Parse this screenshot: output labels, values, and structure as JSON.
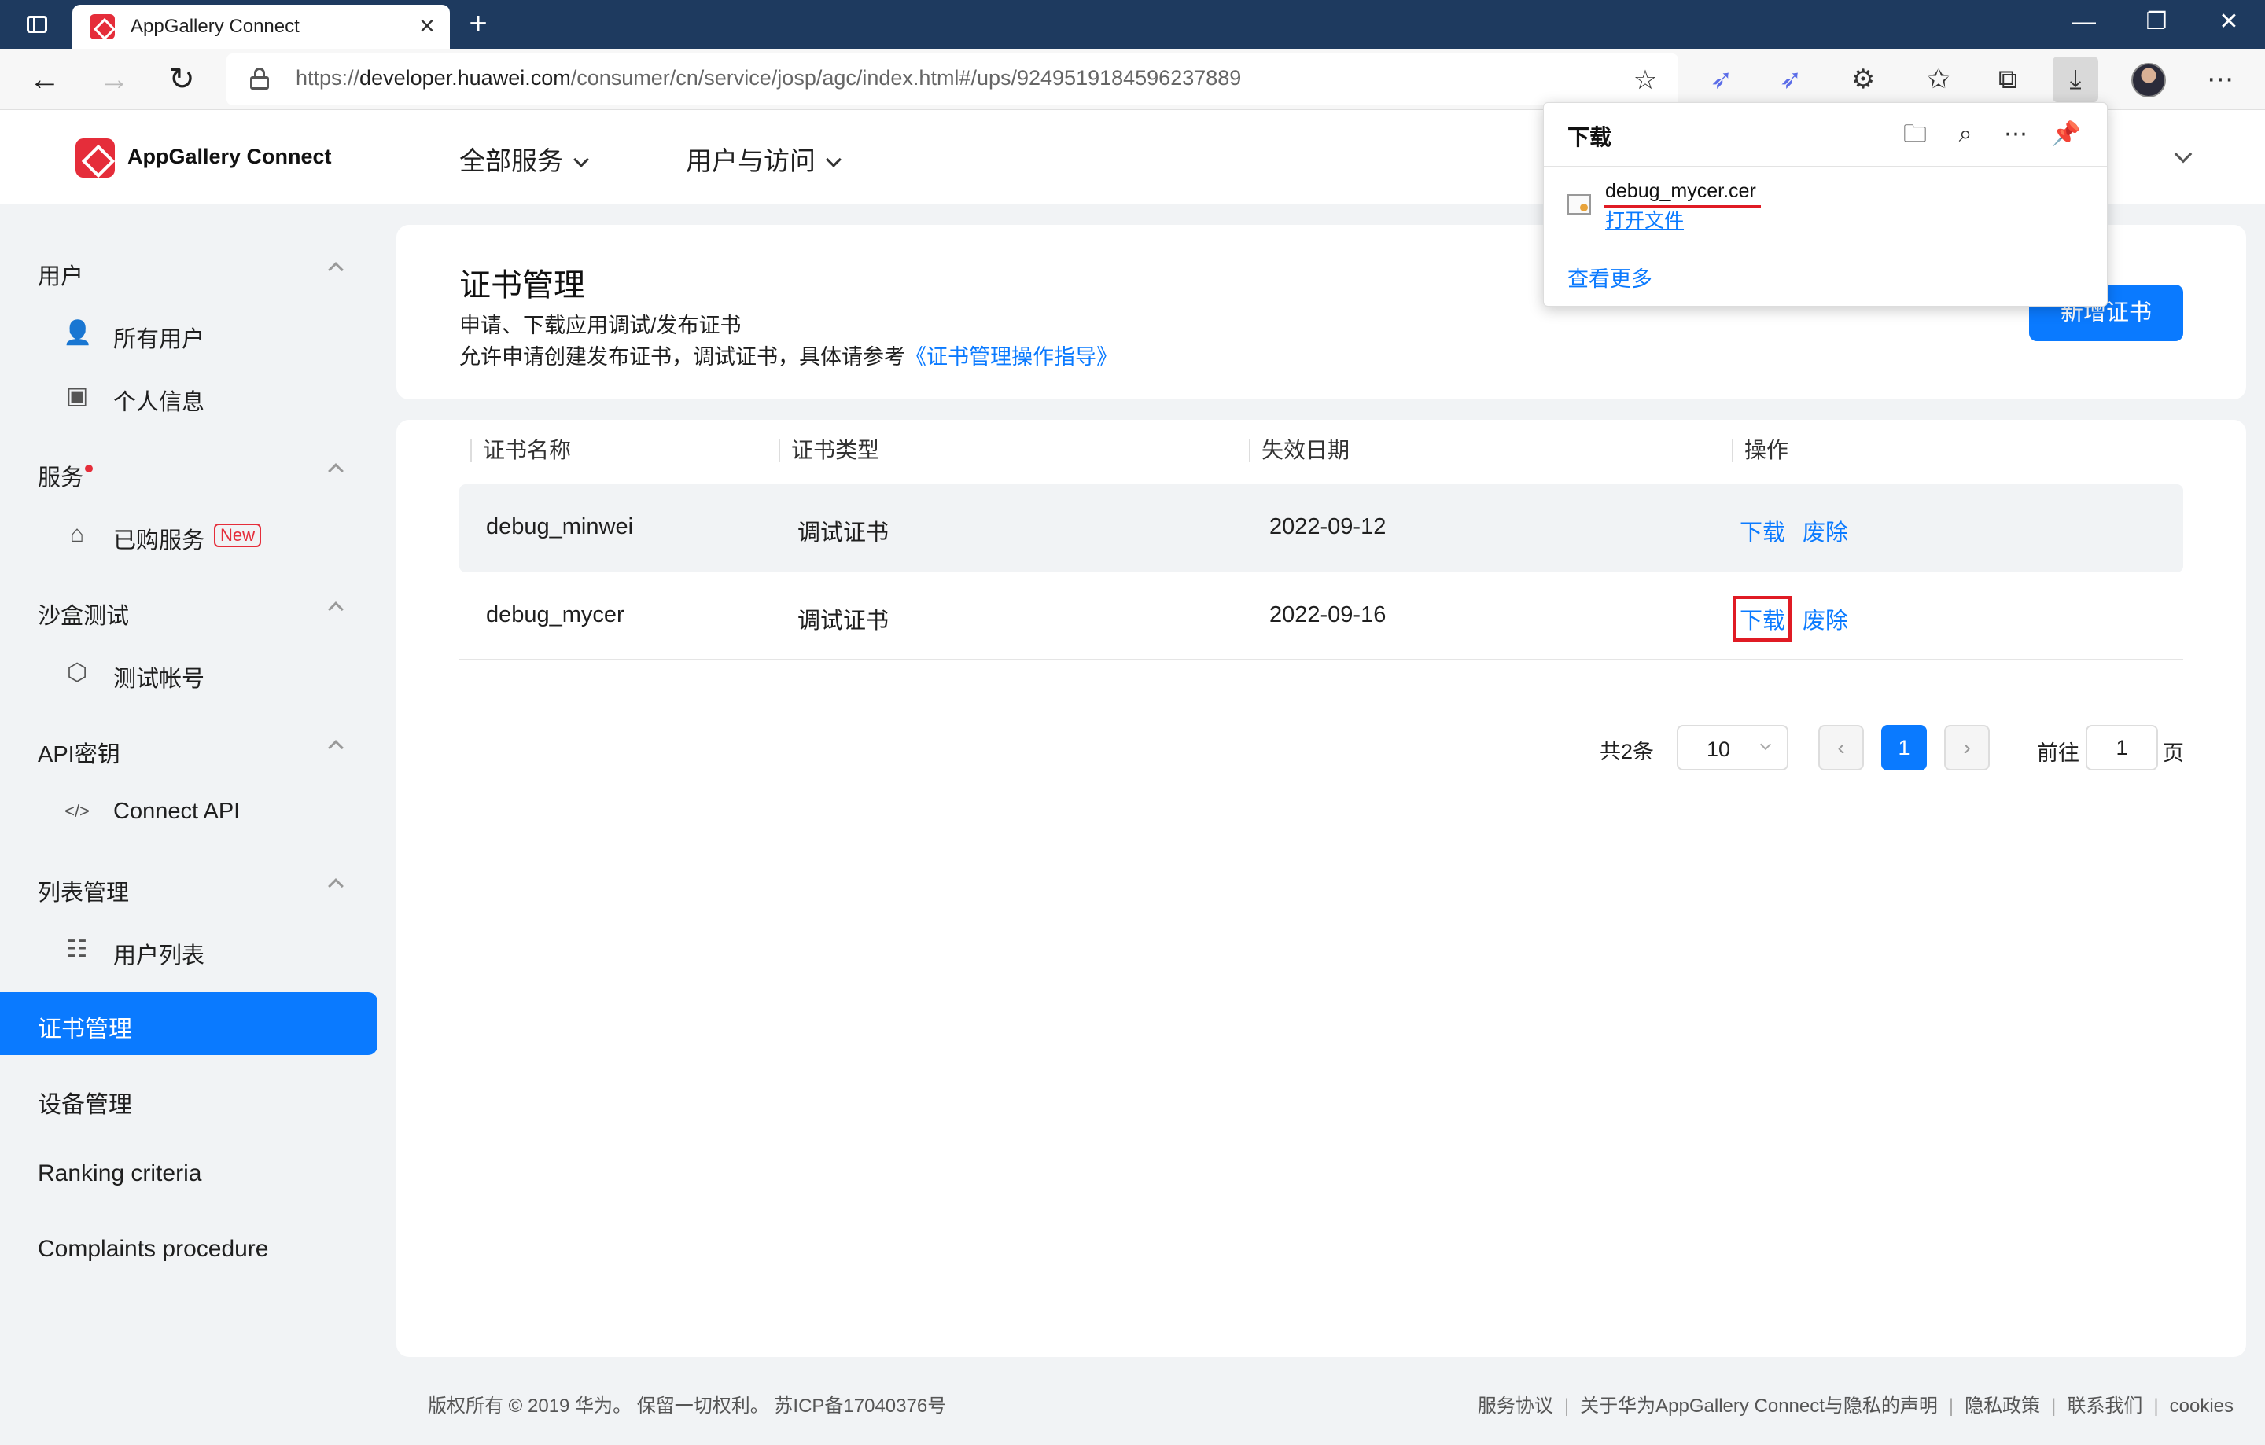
{
  "browser": {
    "tab_title": "AppGallery Connect",
    "url_prefix": "https://",
    "url_host": "developer.huawei.com",
    "url_path": "/consumer/cn/service/josp/agc/index.html#/ups/9249519184596237889"
  },
  "header": {
    "brand": "AppGallery Connect",
    "nav": [
      "全部服务",
      "用户与访问"
    ]
  },
  "sidebar": {
    "sections": [
      {
        "title": "用户",
        "items": [
          {
            "label": "所有用户",
            "icon": "all-users-icon"
          },
          {
            "label": "个人信息",
            "icon": "profile-card-icon"
          }
        ]
      },
      {
        "title": "服务",
        "items": [
          {
            "label": "已购服务",
            "icon": "shopping-bag-icon",
            "badge": "New"
          }
        ]
      },
      {
        "title": "沙盒测试",
        "items": [
          {
            "label": "测试帐号",
            "icon": "cube-icon"
          }
        ]
      },
      {
        "title": "API密钥",
        "items": [
          {
            "label": "Connect API",
            "icon": "api-code-icon"
          }
        ]
      },
      {
        "title": "列表管理",
        "items": [
          {
            "label": "用户列表",
            "icon": "user-list-icon"
          }
        ]
      }
    ],
    "active_item": "证书管理",
    "plain_items": [
      "设备管理",
      "Ranking criteria",
      "Complaints procedure"
    ]
  },
  "page": {
    "title": "证书管理",
    "desc1": "申请、下载应用调试/发布证书",
    "desc2_prefix": "允许申请创建发布证书，调试证书，具体请参考",
    "desc2_link": "《证书管理操作指导》",
    "new_button": "新增证书"
  },
  "table": {
    "columns": [
      "证书名称",
      "证书类型",
      "失效日期",
      "操作"
    ],
    "rows": [
      {
        "name": "debug_minwei",
        "type": "调试证书",
        "expiry": "2022-09-12",
        "download": "下载",
        "revoke": "废除"
      },
      {
        "name": "debug_mycer",
        "type": "调试证书",
        "expiry": "2022-09-16",
        "download": "下载",
        "revoke": "废除"
      }
    ]
  },
  "pager": {
    "total": "共2条",
    "page_size": "10",
    "current_page": "1",
    "goto_label": "前往",
    "goto_value": "1",
    "page_suffix": "页"
  },
  "footer": {
    "copyright": "版权所有 © 2019 华为。 保留一切权利。 苏ICP备17040376号",
    "links": [
      "服务协议",
      "关于华为AppGallery Connect与隐私的声明",
      "隐私政策",
      "联系我们",
      "cookies"
    ]
  },
  "downloads_panel": {
    "title": "下载",
    "file_name": "debug_mycer.cer",
    "open_file": "打开文件",
    "see_more": "查看更多"
  },
  "colors": {
    "accent": "#0a7aff",
    "brand_red": "#e52d3a",
    "titlebar": "#1e3a5f"
  }
}
